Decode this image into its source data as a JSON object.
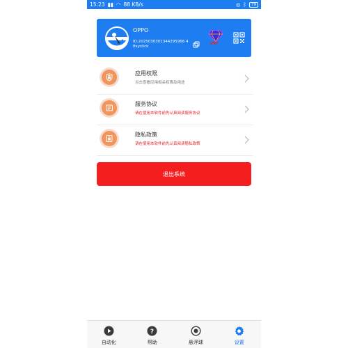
{
  "status_bar": {
    "time": "15:23",
    "network_speed": "88 KB/s",
    "battery": "79"
  },
  "profile": {
    "name": "OPPO",
    "id": "ID:2025030301344295968 48xyclick",
    "vip_label": "VIP"
  },
  "menu": [
    {
      "title": "应用权限",
      "subtitle": "点击查看应用相关权限及用途",
      "icon": "lock-icon",
      "subtitle_color": "#777777"
    },
    {
      "title": "服务协议",
      "subtitle": "请在使用本软件前先认真阅读服务协议",
      "icon": "document-icon",
      "subtitle_color": "#e52222"
    },
    {
      "title": "隐私政策",
      "subtitle": "请在使用本软件前先认真阅读隐私政策",
      "icon": "privacy-icon",
      "subtitle_color": "#e52222"
    }
  ],
  "logout_label": "退出系统",
  "nav": [
    {
      "label": "自动化",
      "icon": "play-icon"
    },
    {
      "label": "帮助",
      "icon": "help-icon"
    },
    {
      "label": "悬浮球",
      "icon": "record-icon"
    },
    {
      "label": "设置",
      "icon": "gear-icon",
      "active": true
    }
  ],
  "colors": {
    "primary": "#1e7df0",
    "danger": "#f41e1e",
    "icon_orange": "#f0955e"
  }
}
